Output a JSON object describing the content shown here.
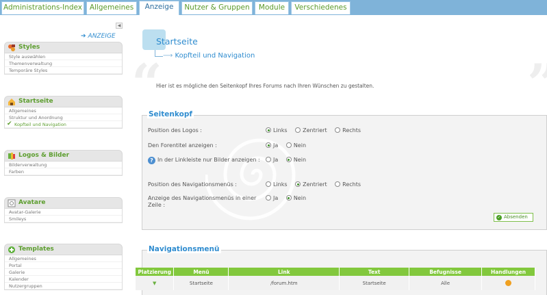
{
  "tabs": [
    {
      "label": "Administrations-Index",
      "active": false
    },
    {
      "label": "Allgemeines",
      "active": false
    },
    {
      "label": "Anzeige",
      "active": true
    },
    {
      "label": "Nutzer & Gruppen",
      "active": false
    },
    {
      "label": "Module",
      "active": false
    },
    {
      "label": "Verschiedenes",
      "active": false
    }
  ],
  "sidebar": {
    "section_link": "ANZEIGE",
    "collapse_icon": "chevron-left-icon",
    "boxes": [
      {
        "title": "Styles",
        "icon": "styles-icon",
        "items": [
          "Style auswählen",
          "Themenverwaltung",
          "Temporäre Styles"
        ],
        "current": null
      },
      {
        "title": "Startseite",
        "icon": "home-icon",
        "items": [
          "Allgemeines",
          "Struktur und Anordnung",
          "Kopfteil und Navigation"
        ],
        "current": 2
      },
      {
        "title": "Logos & Bilder",
        "icon": "image-icon",
        "items": [
          "Bilderverwaltung",
          "Farben"
        ],
        "current": null
      },
      {
        "title": "Avatare",
        "icon": "avatar-icon",
        "items": [
          "Avatar-Galerie",
          "Smileys"
        ],
        "current": null
      },
      {
        "title": "Templates",
        "icon": "templates-icon",
        "items": [
          "Allgemeines",
          "Portal",
          "Galerie",
          "Kalender",
          "Nutzergruppen"
        ],
        "current": null
      }
    ]
  },
  "main": {
    "title": "Startseite",
    "subtitle": "Kopfteil und Navigation",
    "intro": "Hier ist es mögliche den Seitenkopf Ihres Forums nach Ihren Wünschen zu gestalten.",
    "header_section": {
      "legend": "Seitenkopf",
      "rows": [
        {
          "label": "Position des Logos :",
          "help": false,
          "options": [
            "Links",
            "Zentriert",
            "Rechts"
          ],
          "selected": 0
        },
        {
          "label": "Den Forentitel anzeigen :",
          "help": false,
          "options": [
            "Ja",
            "Nein"
          ],
          "selected": 0
        },
        {
          "label": "In der Linkleiste nur Bilder anzeigen :",
          "help": true,
          "options": [
            "Ja",
            "Nein"
          ],
          "selected": 1
        },
        {
          "label": "Position des Navigationsmenüs :",
          "help": false,
          "options": [
            "Links",
            "Zentriert",
            "Rechts"
          ],
          "selected": 1
        },
        {
          "label": "Anzeige des Navigationsmenüs in einer Zeile :",
          "help": false,
          "options": [
            "Ja",
            "Nein"
          ],
          "selected": 1
        }
      ],
      "submit_label": "Absenden"
    },
    "nav_section": {
      "legend": "Navigationsmenü",
      "columns": [
        "Platzierung",
        "Menü",
        "Link",
        "Text",
        "Befugnisse",
        "Handlungen"
      ],
      "rows": [
        {
          "placement_icon": "down-arrow-icon",
          "menu": "Startseite",
          "link": "/forum.htm",
          "text": "Startseite",
          "permissions": "Alle",
          "action_icon": "edit-icon"
        }
      ]
    }
  }
}
